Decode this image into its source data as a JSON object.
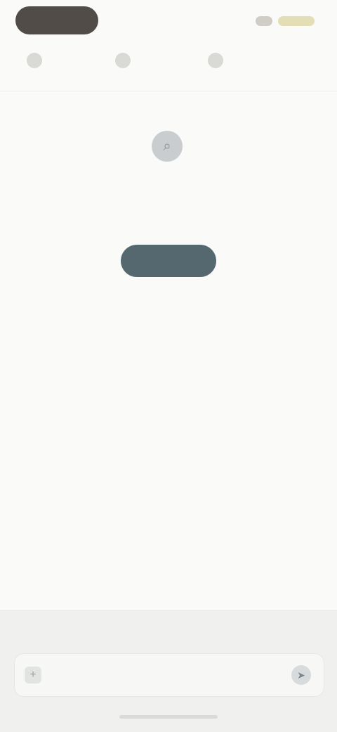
{
  "status": {
    "left_pill_label": "",
    "right_chips": [
      "",
      ""
    ]
  },
  "toolbar": {
    "icons": [
      "menu-icon",
      "filter-icon",
      "profile-icon"
    ]
  },
  "empty_state": {
    "icon": "search-icon",
    "title": "",
    "description": "",
    "button_label": ""
  },
  "composer": {
    "label": "",
    "placeholder": "",
    "left_icon": "plus-icon",
    "right_icon": "send-icon"
  },
  "colors": {
    "background": "#fafaf8",
    "primary_button": "#556870",
    "status_pill": "#514c47",
    "status_accent": "#e4deb6"
  }
}
